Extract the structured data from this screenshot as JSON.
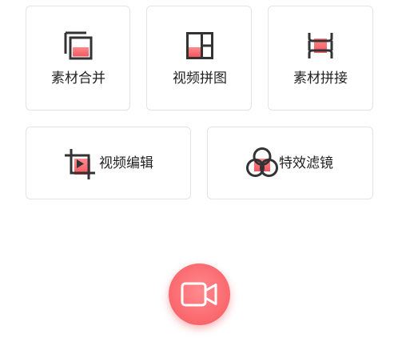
{
  "tools": {
    "material_merge": {
      "label": "素材合并",
      "icon": "layers-merge-icon"
    },
    "video_collage": {
      "label": "视频拼图",
      "icon": "grid-layout-icon"
    },
    "material_splice": {
      "label": "素材拼接",
      "icon": "film-splice-icon"
    },
    "video_edit": {
      "label": "视频编辑",
      "icon": "crop-play-icon"
    },
    "effects_filter": {
      "label": "特效滤镜",
      "icon": "filter-circles-icon"
    }
  },
  "record_button": {
    "icon": "video-camera-icon"
  },
  "colors": {
    "accent": "#f4585f",
    "accent_light": "#ff8a8e",
    "icon_stroke": "#333333",
    "card_border": "#e4e4e4",
    "label_text": "#222222"
  }
}
